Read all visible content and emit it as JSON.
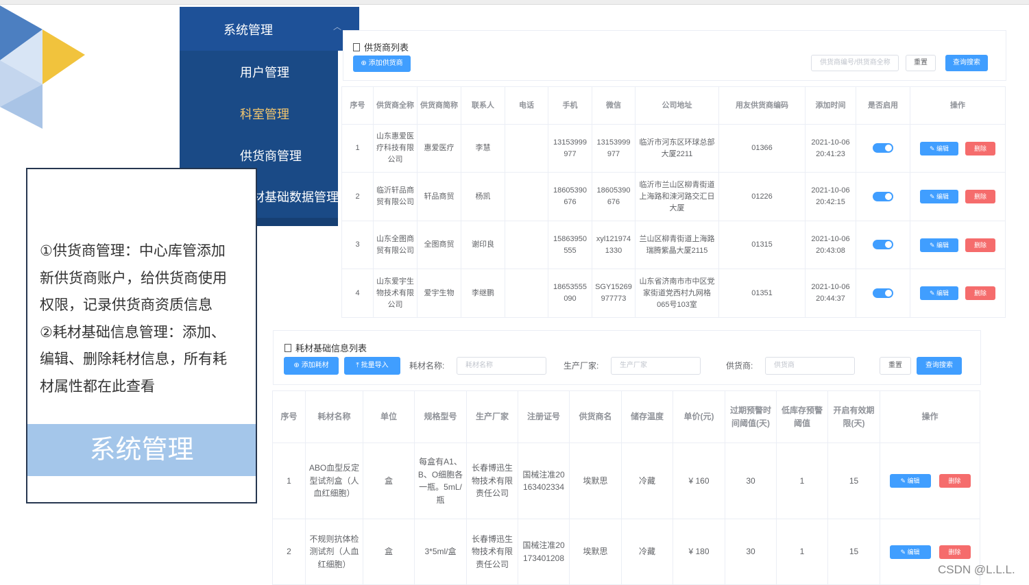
{
  "menu": {
    "title": "系统管理",
    "items": [
      {
        "label": "用户管理",
        "active": false
      },
      {
        "label": "科室管理",
        "active": true
      },
      {
        "label": "供货商管理",
        "active": false
      },
      {
        "label": "耗材基础数据管理",
        "active": false
      }
    ]
  },
  "note": {
    "lines": [
      "①供货商管理：中心库管添加",
      "新供货商账户，给供货商使用",
      "权限，记录供货商资质信息",
      "②耗材基础信息管理：添加、",
      "编辑、删除耗材信息，所有耗",
      "材属性都在此查看"
    ],
    "banner": "系统管理"
  },
  "supplier": {
    "title": "供货商列表",
    "add_label": "添加供货商",
    "search_placeholder": "供货商编号/供货商全称",
    "reset_label": "重置",
    "query_label": "查询搜索",
    "columns": [
      "序号",
      "供货商全称",
      "供货商简称",
      "联系人",
      "电话",
      "手机",
      "微信",
      "公司地址",
      "用友供货商编码",
      "添加时间",
      "是否启用",
      "操作"
    ],
    "rows": [
      {
        "no": "1",
        "full": "山东惠爱医疗科技有限公司",
        "short": "惠爱医疗",
        "contact": "李慧",
        "phone": "",
        "mobile": "13153999977",
        "wechat": "13153999977",
        "address": "临沂市河东区环球总部大厦2211",
        "code": "01366",
        "time": "2021-10-06 20:41:23"
      },
      {
        "no": "2",
        "full": "临沂轩品商贸有限公司",
        "short": "轩品商贸",
        "contact": "杨凯",
        "phone": "",
        "mobile": "18605390676",
        "wechat": "18605390676",
        "address": "临沂市兰山区柳青街道上海路和涑河路交汇日大厦",
        "code": "01226",
        "time": "2021-10-06 20:42:15"
      },
      {
        "no": "3",
        "full": "山东全图商贸有限公司",
        "short": "全图商贸",
        "contact": "谢印良",
        "phone": "",
        "mobile": "15863950555",
        "wechat": "xyl1219741330",
        "address": "兰山区柳青街道上海路瑞腾紫晶大厦2115",
        "code": "01315",
        "time": "2021-10-06 20:43:08"
      },
      {
        "no": "4",
        "full": "山东爱宇生物技术有限公司",
        "short": "爱宇生物",
        "contact": "李继鹏",
        "phone": "",
        "mobile": "18653555090",
        "wechat": "SGY15269977773",
        "address": "山东省济南市市中区党家街道党西村九网格065号103室",
        "code": "01351",
        "time": "2021-10-06 20:44:37"
      }
    ],
    "edit_label": "编辑",
    "delete_label": "删除"
  },
  "material": {
    "title": "耗材基础信息列表",
    "add_label": "添加耗材",
    "import_label": "批量导入",
    "name_label": "耗材名称:",
    "name_placeholder": "耗材名称",
    "maker_label": "生产厂家:",
    "maker_placeholder": "生产厂家",
    "supplier_label": "供货商:",
    "supplier_placeholder": "供货商",
    "reset_label": "重置",
    "query_label": "查询搜索",
    "columns": [
      "序号",
      "耗材名称",
      "单位",
      "规格型号",
      "生产厂家",
      "注册证号",
      "供货商名",
      "储存温度",
      "单价(元)",
      "过期预警时间阈值(天)",
      "低库存预警阈值",
      "开启有效期限(天)",
      "操作"
    ],
    "rows": [
      {
        "no": "1",
        "name": "ABO血型反定型试剂盒（人血红细胞）",
        "unit": "盒",
        "spec": "每盒有A1、B、O细胞各一瓶。5mL/瓶",
        "maker": "长春博迅生物技术有限责任公司",
        "reg": "国械注准20163402334",
        "supplier": "埃默思",
        "temp": "冷藏",
        "price": "¥ 160",
        "expire_warn": "30",
        "stock_warn": "1",
        "valid_days": "15"
      },
      {
        "no": "2",
        "name": "不规则抗体检测试剂（人血红细胞）",
        "unit": "盒",
        "spec": "3*5ml/盒",
        "maker": "长春博迅生物技术有限责任公司",
        "reg": "国械注准20173401208",
        "supplier": "埃默思",
        "temp": "冷藏",
        "price": "¥ 180",
        "expire_warn": "30",
        "stock_warn": "1",
        "valid_days": "15"
      }
    ],
    "edit_label": "编辑",
    "delete_label": "删除"
  },
  "watermark": "CSDN @L.L.L.",
  "colors": {
    "menu_bg": "#1a4a86",
    "primary": "#409eff",
    "danger": "#f56c6c",
    "banner": "#a4c6ea",
    "active_menu": "#f3c66e"
  }
}
